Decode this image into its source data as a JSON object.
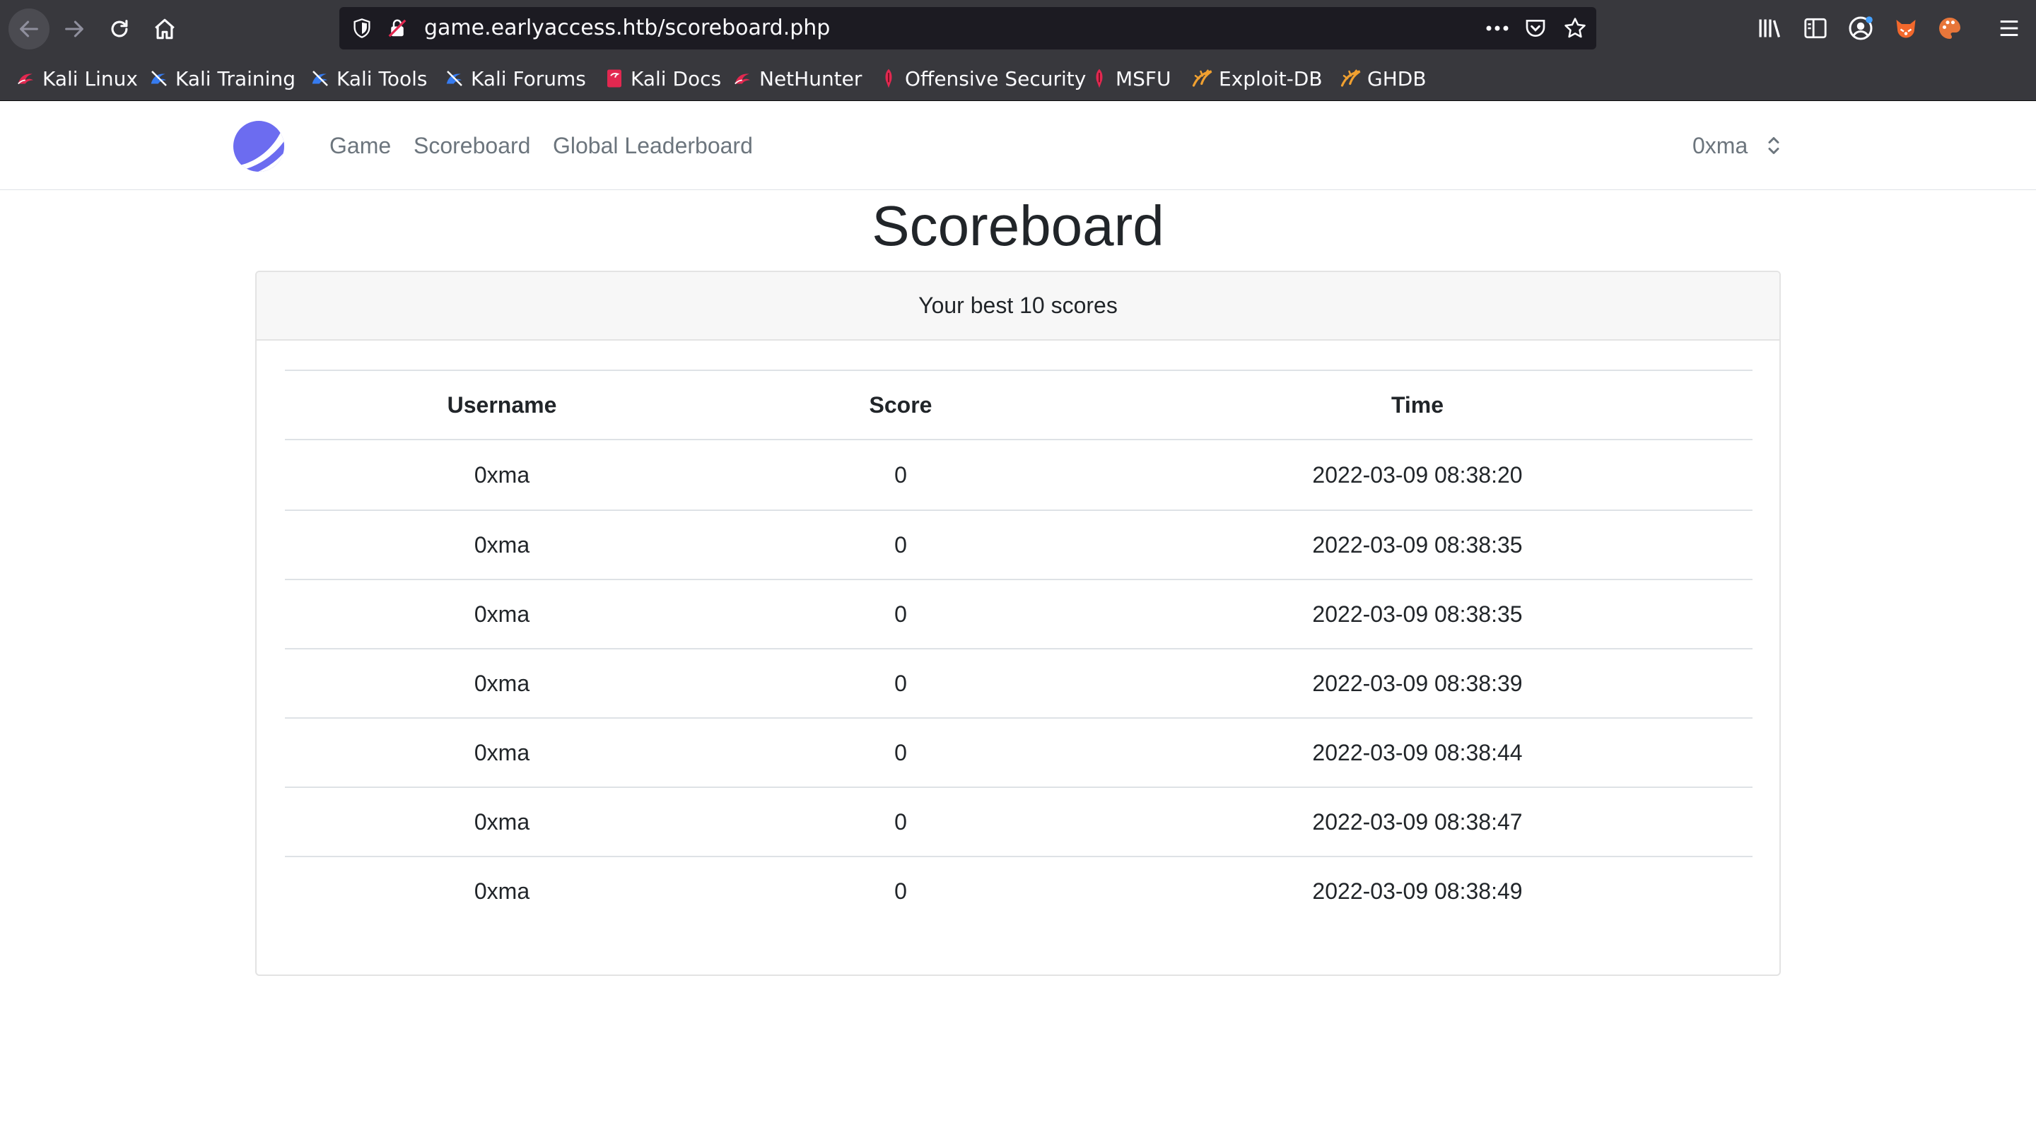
{
  "browser": {
    "url": "game.earlyaccess.htb/scoreboard.php",
    "bookmarks": [
      {
        "label": "Kali Linux",
        "icon": "kali-dragon-icon"
      },
      {
        "label": "Kali Training",
        "icon": "kali-training-icon"
      },
      {
        "label": "Kali Tools",
        "icon": "kali-tools-icon"
      },
      {
        "label": "Kali Forums",
        "icon": "kali-forums-icon"
      },
      {
        "label": "Kali Docs",
        "icon": "kali-docs-icon"
      },
      {
        "label": "NetHunter",
        "icon": "nethunter-icon"
      },
      {
        "label": "Offensive Security",
        "icon": "offsec-icon"
      },
      {
        "label": "MSFU",
        "icon": "msfu-icon"
      },
      {
        "label": "Exploit-DB",
        "icon": "exploit-db-icon"
      },
      {
        "label": "GHDB",
        "icon": "ghdb-icon"
      }
    ],
    "colors": {
      "chrome": "#38383d",
      "urlbar": "#1c1b22",
      "text": "#fbfbfe"
    }
  },
  "site": {
    "nav": [
      {
        "label": "Game"
      },
      {
        "label": "Scoreboard"
      },
      {
        "label": "Global Leaderboard"
      }
    ],
    "user": "0xma",
    "logo_color": "#6c6cf0"
  },
  "page": {
    "title": "Scoreboard",
    "card_header": "Your best 10 scores",
    "table": {
      "columns": [
        "Username",
        "Score",
        "Time"
      ],
      "rows": [
        {
          "username": "0xma",
          "score": "0",
          "time": "2022-03-09 08:38:20"
        },
        {
          "username": "0xma",
          "score": "0",
          "time": "2022-03-09 08:38:35"
        },
        {
          "username": "0xma",
          "score": "0",
          "time": "2022-03-09 08:38:35"
        },
        {
          "username": "0xma",
          "score": "0",
          "time": "2022-03-09 08:38:39"
        },
        {
          "username": "0xma",
          "score": "0",
          "time": "2022-03-09 08:38:44"
        },
        {
          "username": "0xma",
          "score": "0",
          "time": "2022-03-09 08:38:47"
        },
        {
          "username": "0xma",
          "score": "0",
          "time": "2022-03-09 08:38:49"
        }
      ]
    }
  }
}
